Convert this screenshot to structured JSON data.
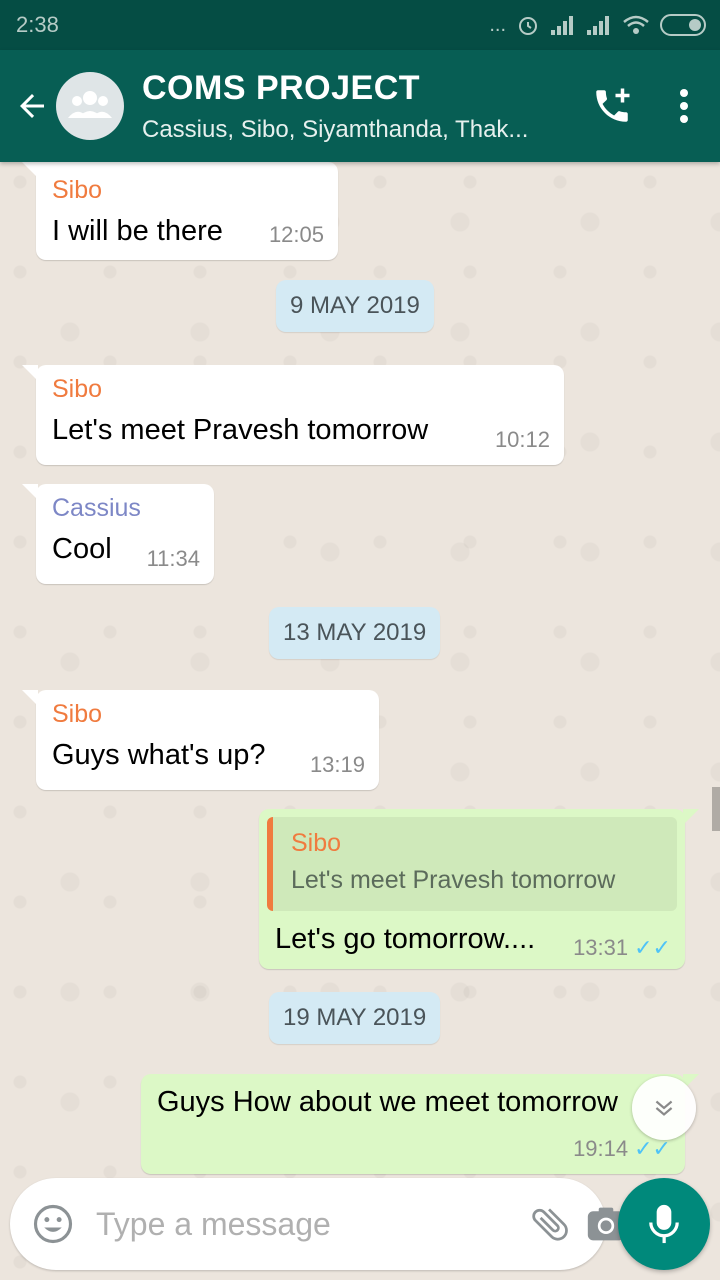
{
  "status_bar": {
    "time": "2:38",
    "icons": [
      "dots-icon",
      "alarm-icon",
      "signal-icon",
      "signal-icon",
      "wifi-icon",
      "battery-icon"
    ],
    "dots": "..."
  },
  "header": {
    "title": "COMS PROJECT",
    "subtitle": "Cassius, Sibo, Siyamthanda, Thak...",
    "icons": [
      "back-arrow-icon",
      "group-avatar-icon",
      "add-call-icon",
      "more-vert-icon"
    ]
  },
  "colors": {
    "appbar": "#075e54",
    "statusbar": "#054d44",
    "outgoing": "#dcf8c6",
    "incoming": "#ffffff",
    "date_pill": "#d4eaf4",
    "sibo": "#f07b3f",
    "cassius": "#7d87c6",
    "read_ticks": "#4fc3f7",
    "mic_button": "#00897b"
  },
  "messages": [
    {
      "direction": "in",
      "sender": "Sibo",
      "text": "I will be there",
      "time": "12:05"
    },
    {
      "date": "9 MAY 2019"
    },
    {
      "direction": "in",
      "sender": "Sibo",
      "text": "Let's meet Pravesh tomorrow",
      "time": "10:12"
    },
    {
      "direction": "in",
      "sender": "Cassius",
      "text": "Cool",
      "time": "11:34"
    },
    {
      "date": "13 MAY 2019"
    },
    {
      "direction": "in",
      "sender": "Sibo",
      "text": "Guys what's up?",
      "time": "13:19"
    },
    {
      "direction": "out",
      "quote": {
        "sender": "Sibo",
        "text": "Let's meet Pravesh tomorrow"
      },
      "text": "Let's go tomorrow....",
      "time": "13:31",
      "ticks": "✓✓"
    },
    {
      "date": "19 MAY 2019"
    },
    {
      "direction": "out",
      "text": "Guys How about we meet tomorrow",
      "time": "19:14",
      "ticks": "✓✓"
    }
  ],
  "composer": {
    "placeholder": "Type a message",
    "icons": [
      "emoji-icon",
      "attach-icon",
      "camera-icon",
      "mic-icon"
    ]
  },
  "scroll_button": {
    "icon": "double-chevron-down-icon"
  }
}
